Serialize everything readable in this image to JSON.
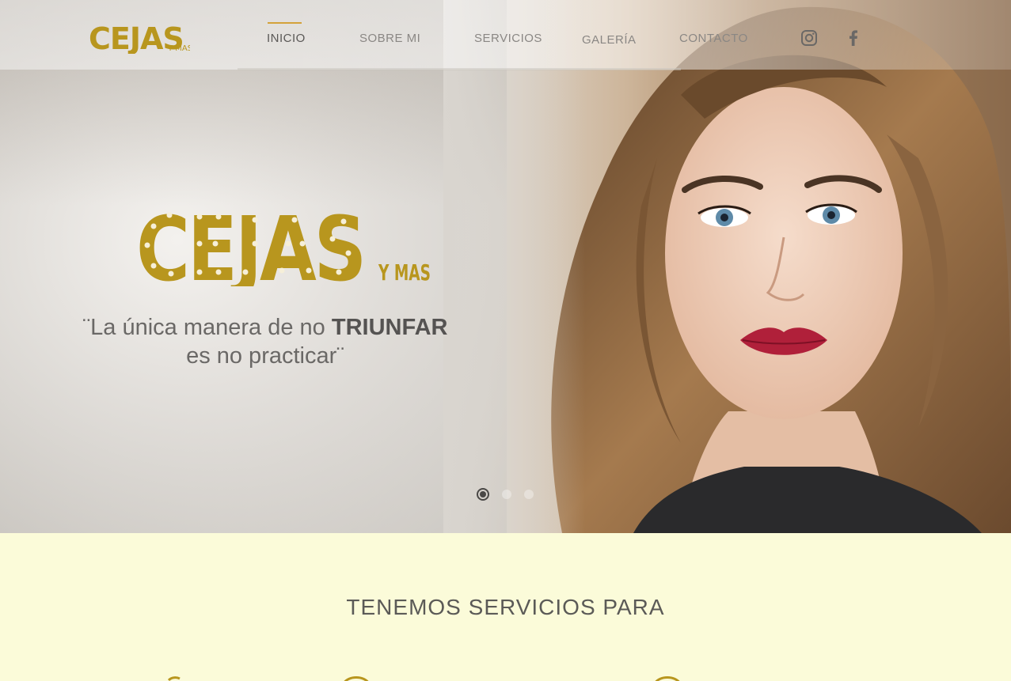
{
  "brand": {
    "logo_text": "CEJAS",
    "logo_suffix": "Y MAS",
    "gold": "#b8961e",
    "gold_dark": "#9a7c12"
  },
  "nav": {
    "items": [
      {
        "label": "INICIO",
        "active": true
      },
      {
        "label": "SOBRE MI",
        "active": false
      },
      {
        "label": "SERVICIOS",
        "active": false
      },
      {
        "label": "GALERÍA",
        "active": false
      },
      {
        "label": "CONTACTO",
        "active": false
      }
    ],
    "accent": "#d4a23a"
  },
  "social": {
    "instagram_icon": "instagram-icon",
    "facebook_icon": "facebook-icon"
  },
  "hero": {
    "quote_part1": "¨La única manera de no ",
    "quote_bold": "TRIUNFAR",
    "quote_part2": "es no practicar¨",
    "slides_total": 3,
    "slide_active": 1
  },
  "services": {
    "title": "TENEMOS SERVICIOS PARA"
  }
}
